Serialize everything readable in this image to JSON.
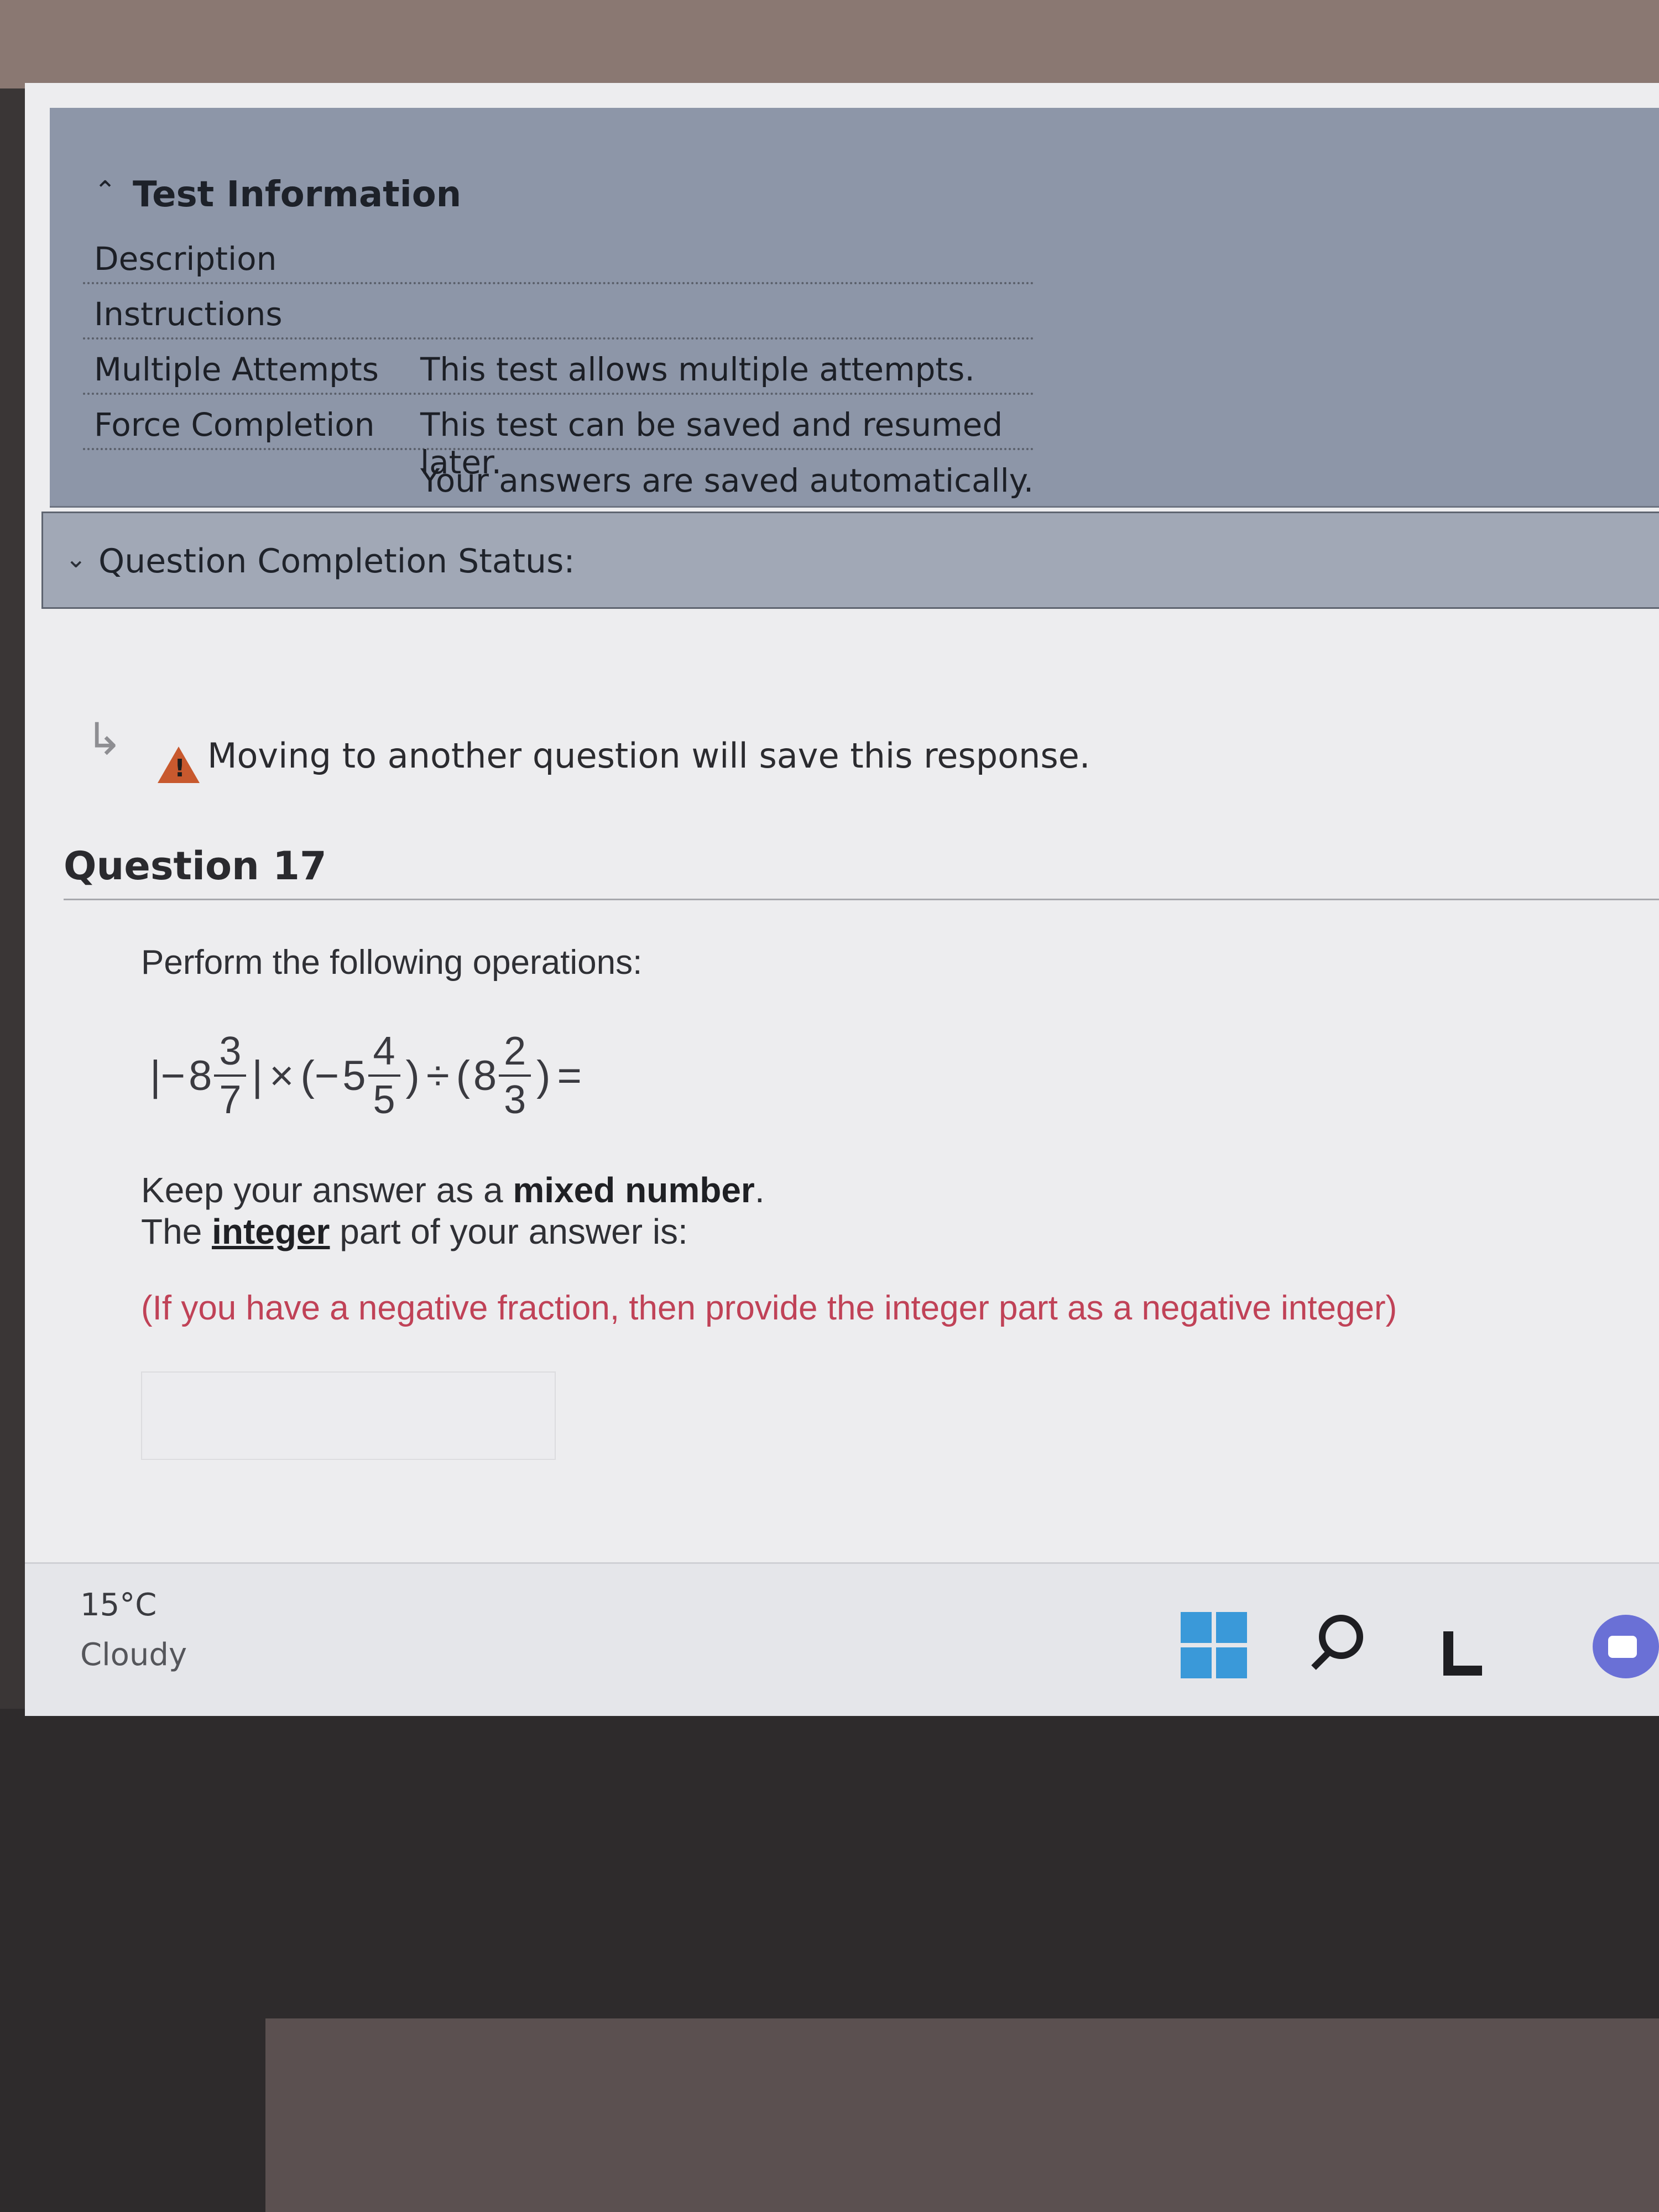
{
  "test_info": {
    "title": "Test Information",
    "rows": [
      {
        "label": "Description",
        "value": ""
      },
      {
        "label": "Instructions",
        "value": ""
      },
      {
        "label": "Multiple Attempts",
        "value": "This test allows multiple attempts."
      },
      {
        "label": "Force Completion",
        "value": "This test can be saved and resumed later."
      }
    ],
    "extra_note": "Your answers are saved automatically."
  },
  "completion_status": {
    "label": "Question Completion Status:"
  },
  "warning": {
    "text": "Moving to another question will save this response.",
    "icon": "warning-icon"
  },
  "question": {
    "title": "Question 17",
    "prompt": "Perform the following operations:",
    "expression": {
      "term1_sign": "|−",
      "term1_whole": "8",
      "term1_num": "3",
      "term1_den": "7",
      "term1_close": "|",
      "times": "×",
      "term2_open": "(−",
      "term2_whole": "5",
      "term2_num": "4",
      "term2_den": "5",
      "term2_close": ")",
      "divide": "÷",
      "term3_open": "(",
      "term3_whole": "8",
      "term3_num": "2",
      "term3_den": "3",
      "term3_close": ")",
      "equals": "="
    },
    "keep_prefix": "Keep your answer as a ",
    "keep_bold": "mixed number",
    "keep_suffix": ".",
    "integer_prefix": "The ",
    "integer_bold": "integer",
    "integer_suffix": " part of your answer is:",
    "hint": "(If you have a negative fraction, then provide the integer part as a negative integer)",
    "answer_value": ""
  },
  "taskbar": {
    "temperature": "15°C",
    "weather": "Cloudy",
    "icons": [
      "start-icon",
      "search-icon",
      "task-view-icon",
      "chat-icon"
    ]
  }
}
